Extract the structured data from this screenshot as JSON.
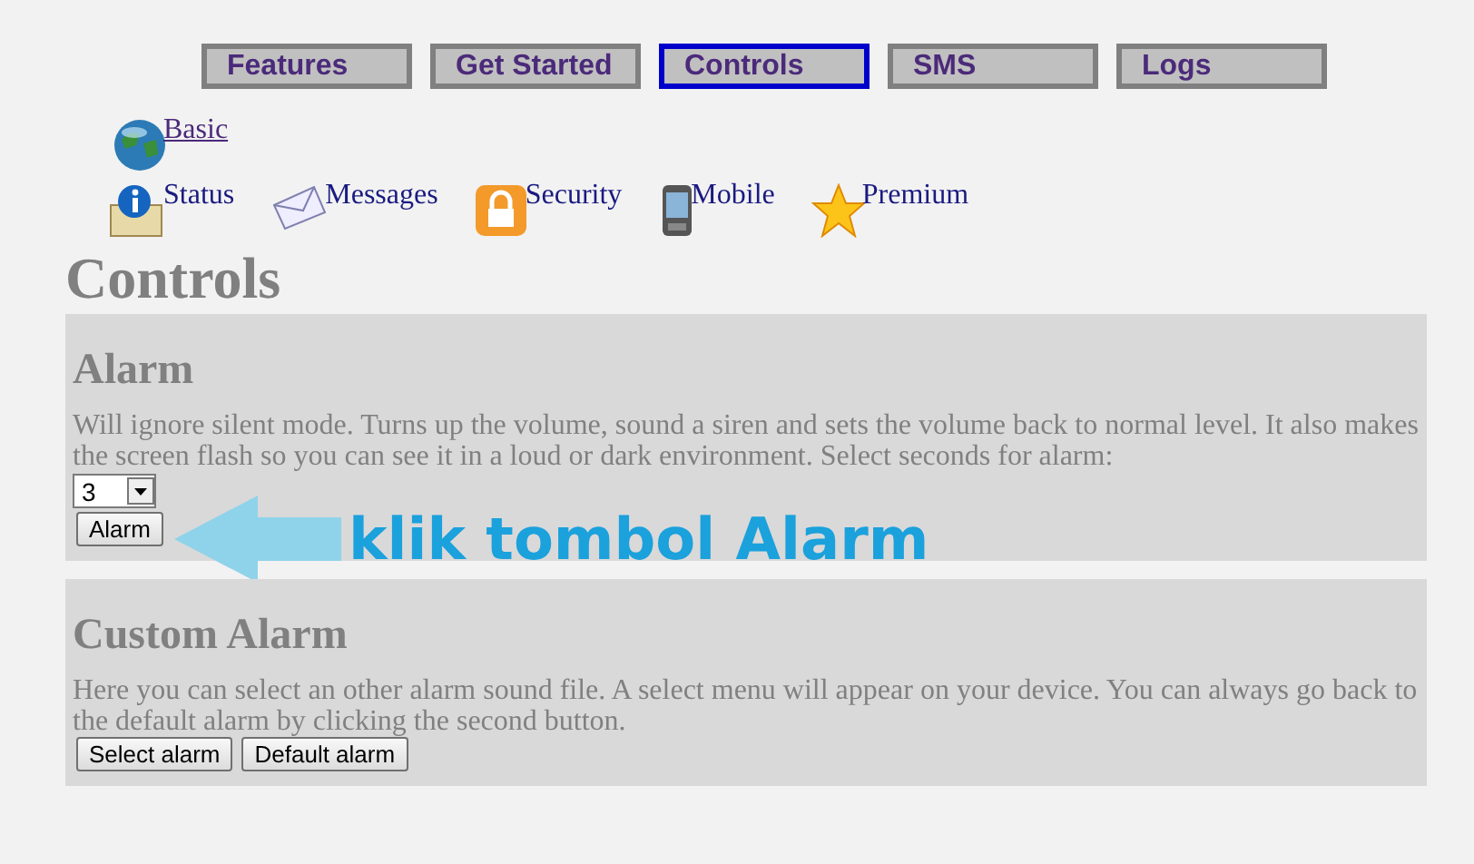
{
  "nav": [
    {
      "label": "Features",
      "selected": false
    },
    {
      "label": "Get Started",
      "selected": false
    },
    {
      "label": "Controls",
      "selected": true
    },
    {
      "label": "SMS",
      "selected": false
    },
    {
      "label": "Logs",
      "selected": false
    }
  ],
  "basic_link": {
    "label": "Basic"
  },
  "sub_links": [
    {
      "label": "Status"
    },
    {
      "label": "Messages"
    },
    {
      "label": "Security"
    },
    {
      "label": "Mobile"
    },
    {
      "label": "Premium"
    }
  ],
  "page_title": "Controls",
  "sections": [
    {
      "title": "Alarm",
      "text": "Will ignore silent mode. Turns up the volume, sound a siren and sets the volume back to normal level. It also makes the screen flash so you can see it in a loud or dark environment. Select seconds for alarm:",
      "select_value": "3",
      "buttons": [
        "Alarm"
      ],
      "annotation": "klik tombol Alarm"
    },
    {
      "title": "Custom Alarm",
      "text": "Here you can select an other alarm sound file. A select menu will appear on your device. You can always go back to the default alarm by clicking the second button.",
      "buttons": [
        "Select alarm",
        "Default alarm"
      ]
    }
  ]
}
